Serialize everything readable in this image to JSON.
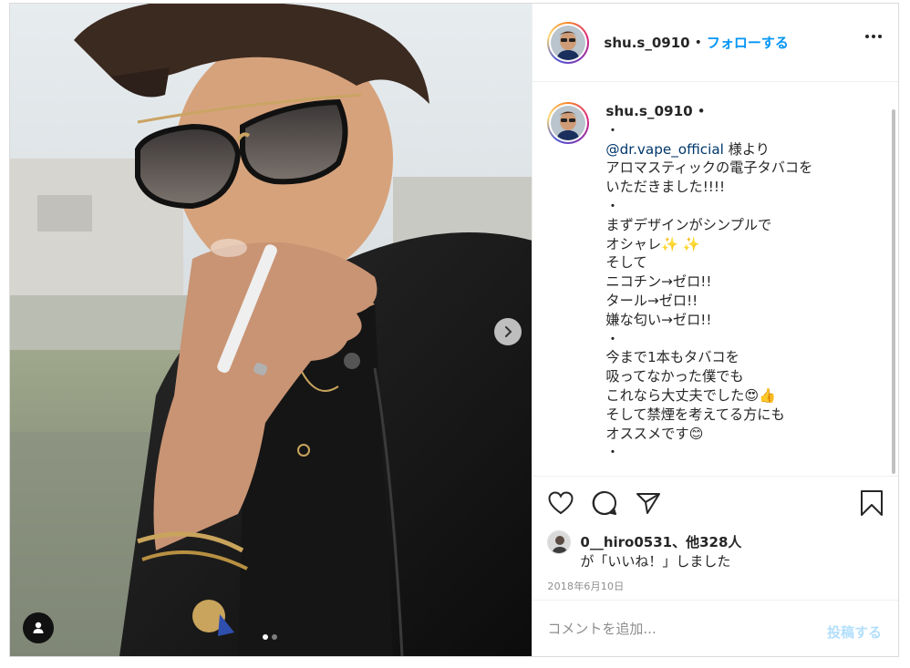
{
  "post": {
    "author": "shu.s_0910",
    "separator": "•",
    "follow_label": "フォローする",
    "more_icon": "more-horizontal-icon"
  },
  "caption": {
    "author": "shu.s_0910",
    "author_suffix": " •",
    "lines": [
      "・",
      "",
      "アロマスティックの電子タバコを",
      "いただきました!!!!",
      "・",
      "まずデザインがシンプルで",
      "オシャレ✨ ✨",
      "そして",
      "ニコチン→ゼロ!!",
      "タール→ゼロ!!",
      "嫌な匂い→ゼロ!!",
      "・",
      "今まで1本もタバコを",
      "吸ってなかった僕でも",
      "これなら大丈夫でした😍👍",
      "そして禁煙を考えてる方にも",
      "オススメです😊",
      "・"
    ],
    "mention": "@dr.vape_official",
    "mention_suffix": " 様より"
  },
  "actions": {
    "like_icon": "heart-icon",
    "comment_icon": "comment-icon",
    "share_icon": "paper-plane-icon",
    "save_icon": "bookmark-icon"
  },
  "likes": {
    "line1": "0__hiro0531、他328人",
    "line2": "が「いいね！」しました"
  },
  "date": "2018年6月10日",
  "comment_box": {
    "placeholder": "コメントを追加...",
    "post_label": "投稿する"
  },
  "carousel": {
    "total": 2,
    "current": 1
  },
  "colors": {
    "accent": "#0095f6",
    "post_disabled": "#b2dffc",
    "mention": "#00376b"
  }
}
